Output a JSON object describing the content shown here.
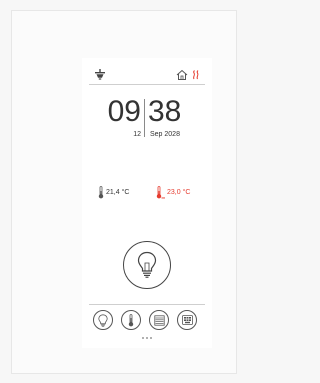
{
  "clock": {
    "hour": "09",
    "minute": "38",
    "day": "12",
    "month_year": "Sep 2028"
  },
  "temperatures": {
    "current": "21,4 °C",
    "setpoint": "23,0 °C"
  },
  "icons": {
    "top_left": "ceiling-fan-icon",
    "top_right_home": "home-icon",
    "top_right_heat": "heating-waves-icon",
    "main": "lightbulb-icon",
    "nav": [
      "lightbulb-icon",
      "thermometer-icon",
      "blind-icon",
      "keypad-icon"
    ]
  },
  "pages": {
    "count": 3
  },
  "colors": {
    "accent_red": "#e63b2e",
    "icon_dark": "#444444",
    "text": "#333333"
  }
}
